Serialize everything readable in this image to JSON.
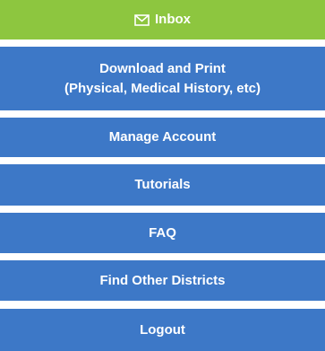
{
  "menu": {
    "items": [
      {
        "label": "Inbox",
        "icon": "envelope-icon",
        "color": "#8dc63f"
      },
      {
        "label": "Download and Print\n(Physical, Medical History, etc)",
        "color": "#3d78c7"
      },
      {
        "label": "Manage Account",
        "color": "#3d78c7"
      },
      {
        "label": "Tutorials",
        "color": "#3d78c7"
      },
      {
        "label": "FAQ",
        "color": "#3d78c7"
      },
      {
        "label": "Find Other Districts",
        "color": "#3d78c7"
      },
      {
        "label": "Logout",
        "color": "#3d78c7"
      }
    ]
  }
}
